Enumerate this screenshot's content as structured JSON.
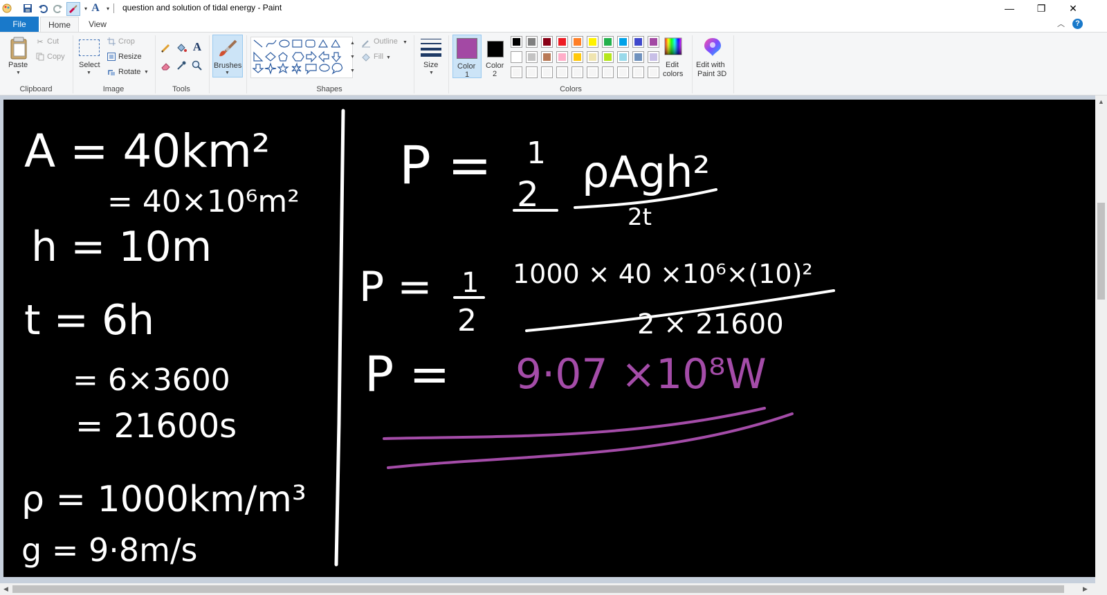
{
  "window": {
    "title": "question and solution of tidal energy - Paint",
    "controls": {
      "minimize": "—",
      "restore": "❐",
      "close": "✕"
    }
  },
  "tabs": [
    {
      "label": "File"
    },
    {
      "label": "Home"
    },
    {
      "label": "View"
    }
  ],
  "ribbon": {
    "clipboard": {
      "paste": "Paste",
      "cut": "Cut",
      "copy": "Copy",
      "group": "Clipboard"
    },
    "image": {
      "select": "Select",
      "crop": "Crop",
      "resize": "Resize",
      "rotate": "Rotate",
      "group": "Image"
    },
    "tools": {
      "group": "Tools"
    },
    "brushes": {
      "label": "Brushes"
    },
    "shapes": {
      "outline": "Outline",
      "fill": "Fill",
      "group": "Shapes"
    },
    "size": {
      "label": "Size"
    },
    "colors": {
      "color1": "Color",
      "color1_num": "1",
      "color2": "Color",
      "color2_num": "2",
      "edit_colors_1": "Edit",
      "edit_colors_2": "colors",
      "paint3d_1": "Edit with",
      "paint3d_2": "Paint 3D",
      "group": "Colors",
      "color1_value": "#a349a4",
      "color2_value": "#000000",
      "palette_row1": [
        "#000000",
        "#7f7f7f",
        "#880015",
        "#ed1c24",
        "#ff7f27",
        "#fff200",
        "#22b14c",
        "#00a2e8",
        "#3f48cc",
        "#a349a4"
      ],
      "palette_row2": [
        "#ffffff",
        "#c3c3c3",
        "#b97a57",
        "#ffaec9",
        "#ffc90e",
        "#efe4b0",
        "#b5e61d",
        "#99d9ea",
        "#7092be",
        "#c8bfe7"
      ],
      "palette_row3": [
        "#f5f5f5",
        "#f5f5f5",
        "#f5f5f5",
        "#f5f5f5",
        "#f5f5f5",
        "#f5f5f5",
        "#f5f5f5",
        "#f5f5f5",
        "#f5f5f5",
        "#f5f5f5"
      ]
    }
  },
  "canvas": {
    "left": {
      "area_line1": "A = 40km²",
      "area_line2": "= 40×10⁶m²",
      "height": "h = 10m",
      "time_line1": "t = 6h",
      "time_line2": "= 6×3600",
      "time_line3": "= 21600s",
      "density": "ρ = 1000km/m³",
      "gravity": "g = 9·8m/s"
    },
    "right": {
      "formula_lhs": "P = ",
      "formula_half_num": "1",
      "formula_half_den": "2",
      "formula_num": "ρAgh²",
      "formula_den": "2t",
      "sub_lhs": "P = ",
      "sub_half_num": "1",
      "sub_half_den": "2",
      "sub_num": "1000 × 40 ×10⁶×(10)²",
      "sub_den": "2 × 21600",
      "result_lhs": "P = ",
      "result_value": "9·07 ×10⁸W"
    }
  }
}
